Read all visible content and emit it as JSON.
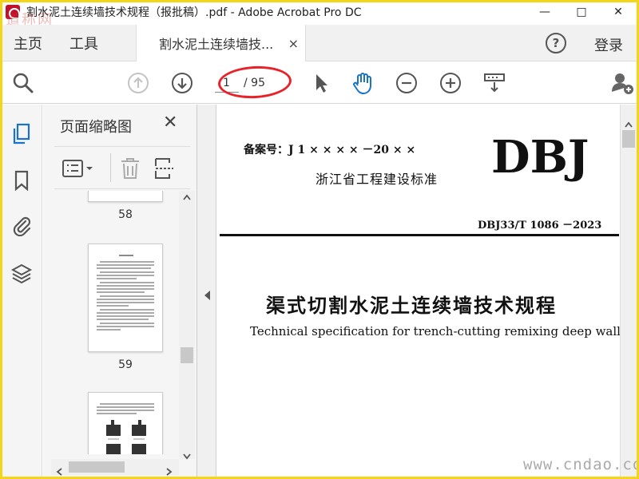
{
  "window": {
    "title": "割水泥土连续墙技术规程（报批稿）.pdf - Adobe Acrobat Pro DC",
    "minimize": "—",
    "maximize": "□",
    "close": "✕"
  },
  "watermark_top": "道称网",
  "tabs": {
    "home": "主页",
    "tools": "工具",
    "document": "割水泥土连续墙技...",
    "document_close": "×",
    "help": "?",
    "login": "登录"
  },
  "toolbar": {
    "current_page": "1",
    "total_pages": "/ 95"
  },
  "panel": {
    "title": "页面缩略图",
    "close": "✕",
    "thumbnails": [
      {
        "label": "58"
      },
      {
        "label": "59"
      }
    ]
  },
  "document": {
    "filing_number": "备案号：J 1 × × × × －20 × ×",
    "logo": "DBJ",
    "province_standard": "浙江省工程建设标准",
    "standard_number": "DBJ33/T 1086 －2023",
    "title_cn": "渠式切割水泥土连续墙技术规程",
    "title_en": "Technical specification for trench-cutting remixing deep wall"
  },
  "watermark_bottom": "www.cndao.com",
  "colors": {
    "frame": "#f2d617",
    "accent_blue": "#1a73c8",
    "annotation_red": "#e8222a",
    "icon_gray": "#555555"
  }
}
